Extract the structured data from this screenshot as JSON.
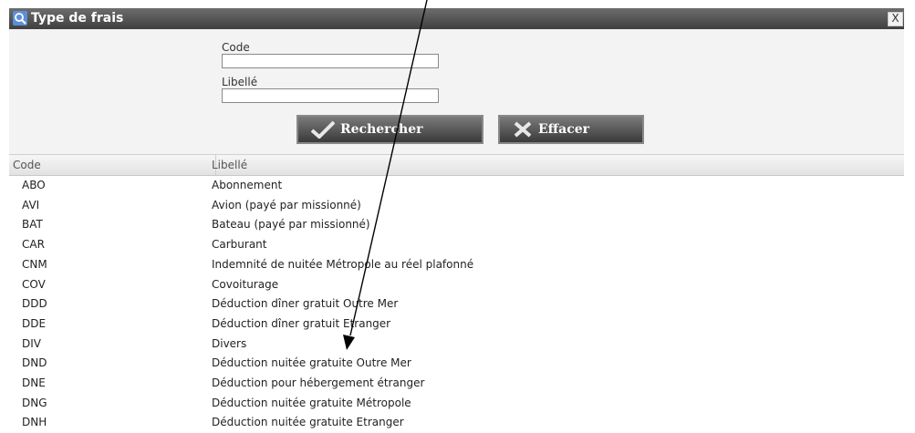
{
  "dialog": {
    "title": "Type de frais",
    "close_label": "X"
  },
  "search": {
    "code_label": "Code",
    "code_value": "",
    "libelle_label": "Libellé",
    "libelle_value": "",
    "search_button": "Rechercher",
    "clear_button": "Effacer"
  },
  "table": {
    "headers": [
      "Code",
      "Libellé"
    ],
    "rows": [
      [
        "ABO",
        "Abonnement"
      ],
      [
        "AVI",
        "Avion (payé par missionné)"
      ],
      [
        "BAT",
        "Bateau (payé par missionné)"
      ],
      [
        "CAR",
        "Carburant"
      ],
      [
        "CNM",
        "Indemnité de nuitée Métropole au réel plafonné"
      ],
      [
        "COV",
        "Covoiturage"
      ],
      [
        "DDD",
        "Déduction dîner gratuit Outre Mer"
      ],
      [
        "DDE",
        "Déduction dîner gratuit Etranger"
      ],
      [
        "DIV",
        "Divers"
      ],
      [
        "DND",
        "Déduction nuitée gratuite Outre Mer"
      ],
      [
        "DNE",
        "Déduction pour hébergement étranger"
      ],
      [
        "DNG",
        "Déduction nuitée gratuite Métropole"
      ],
      [
        "DNH",
        "Déduction nuitée gratuite Etranger"
      ]
    ]
  },
  "colors": {
    "titlebar": "#4a4a4a",
    "panel": "#f3f3f3",
    "arrow": "#000000"
  },
  "icons": {
    "title_icon": "search-icon",
    "close_icon": "close-icon",
    "search_button_icon": "checkmark-icon",
    "clear_button_icon": "cross-icon"
  }
}
